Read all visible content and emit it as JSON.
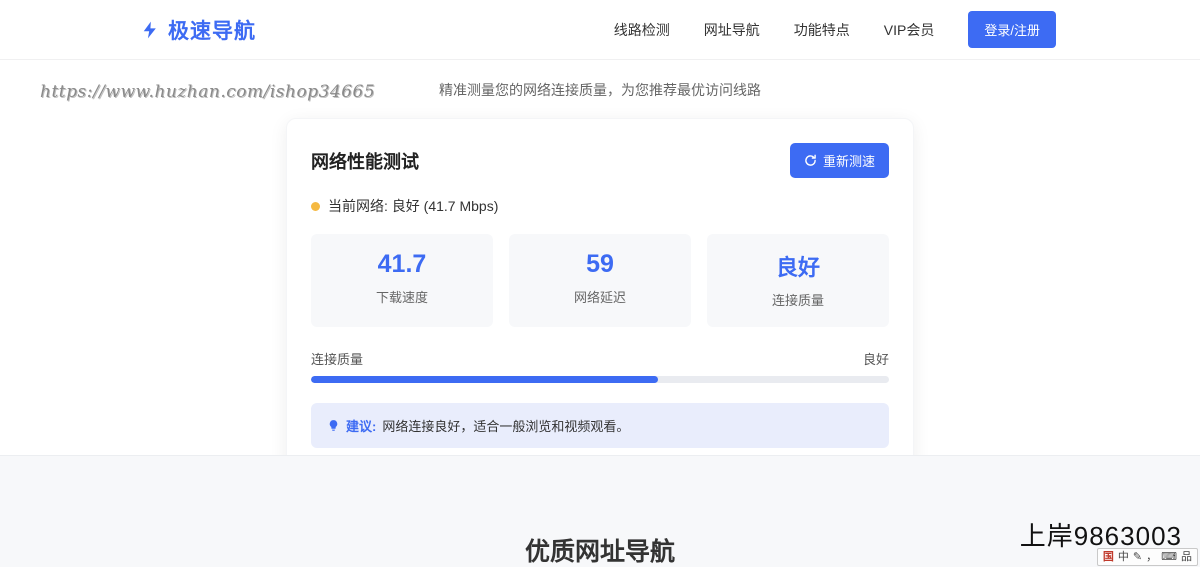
{
  "colors": {
    "primary": "#3d6bf3",
    "status_dot": "#f5b942",
    "suggestion_bg": "#e9edfc"
  },
  "header": {
    "logo_text": "极速导航",
    "logo_icon": "lightning-bolt-icon",
    "nav": [
      {
        "label": "线路检测"
      },
      {
        "label": "网址导航"
      },
      {
        "label": "功能特点"
      },
      {
        "label": "VIP会员"
      }
    ],
    "login_button": "登录/注册"
  },
  "hero": {
    "subtitle": "精准测量您的网络连接质量，为您推荐最优访问线路",
    "watermark": "https://www.huzhan.com/ishop34665"
  },
  "speed_card": {
    "title": "网络性能测试",
    "retest_button": "重新测速",
    "retest_icon": "refresh-icon",
    "status_text": "当前网络: 良好 (41.7 Mbps)",
    "stats": [
      {
        "value": "41.7",
        "label": "下载速度"
      },
      {
        "value": "59",
        "label": "网络延迟"
      },
      {
        "value": "良好",
        "label": "连接质量"
      }
    ],
    "quality": {
      "label": "连接质量",
      "value": "良好",
      "percent": 60,
      "bar_style": "width:60%"
    },
    "suggestion": {
      "icon": "lightbulb-icon",
      "prefix": "建议:",
      "text": "网络连接良好，适合一般浏览和视频观看。"
    }
  },
  "bottom": {
    "section_title": "优质网址导航",
    "watermark2": "上岸9863003"
  },
  "ime": {
    "icons": [
      "国",
      "中",
      "✎",
      "，",
      "⌨",
      "品"
    ]
  }
}
